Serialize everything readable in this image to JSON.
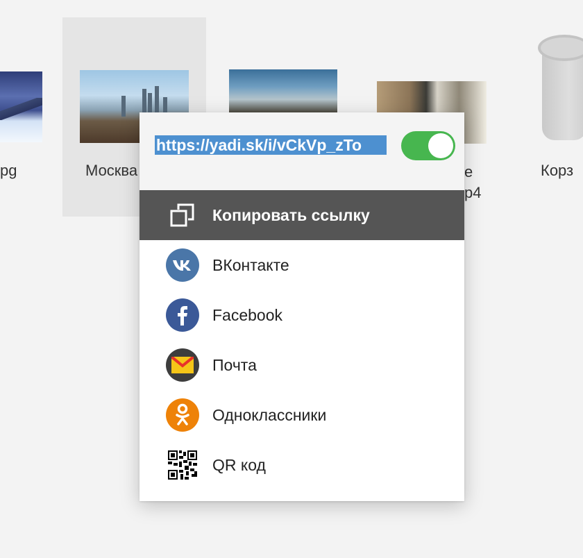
{
  "files": [
    {
      "name": "pg"
    },
    {
      "name": "Москва"
    },
    {
      "name": ""
    },
    {
      "name": "е\nр4"
    },
    {
      "name": "Корз"
    }
  ],
  "share_popup": {
    "link": "https://yadi.sk/i/vCkVp_zTo",
    "toggle_on": true,
    "copy_link_label": "Копировать ссылку",
    "items": [
      {
        "label": "ВКонтакте",
        "icon": "vk-icon",
        "color": "#4a76a8"
      },
      {
        "label": "Facebook",
        "icon": "facebook-icon",
        "color": "#3b5998"
      },
      {
        "label": "Почта",
        "icon": "mail-icon",
        "color": "#3d3d3d"
      },
      {
        "label": "Одноклассники",
        "icon": "odnoklassniki-icon",
        "color": "#ee8208"
      },
      {
        "label": "QR код",
        "icon": "qr-code-icon",
        "color": "#000000"
      }
    ]
  },
  "colors": {
    "toggle_green": "#47b64f",
    "selection_blue": "#4d90d0",
    "active_row": "#555555"
  }
}
